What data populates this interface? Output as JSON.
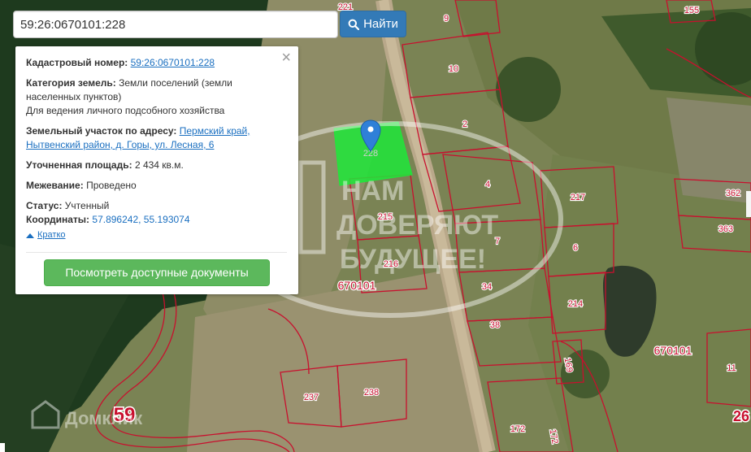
{
  "search": {
    "value": "59:26:0670101:228",
    "button_label": "Найти"
  },
  "popup": {
    "cadastral_label": "Кадастровый номер:",
    "cadastral_value": "59:26:0670101:228",
    "category_label": "Категория земель:",
    "category_value": "Земли поселений (земли населенных пунктов)",
    "usage_value": "Для ведения личного подсобного хозяйства",
    "address_label": "Земельный участок по адресу:",
    "address_value": "Пермский край, Нытвенский район, д. Горы, ул. Лесная, 6",
    "area_label": "Уточненная площадь:",
    "area_value": "2 434 кв.м.",
    "survey_label": "Межевание:",
    "survey_value": "Проведено",
    "status_label": "Статус:",
    "status_value": "Учтенный",
    "coords_label": "Координаты:",
    "coords_value": "57.896242, 55.193074",
    "collapse_label": "Кратко",
    "docs_button_label": "Посмотреть доступные документы"
  },
  "map": {
    "parcel_labels": [
      "221",
      "9",
      "155",
      "10",
      "2",
      "4",
      "217",
      "362",
      "215",
      "7",
      "6",
      "363",
      "216",
      "34",
      "214",
      "38",
      "169",
      "11",
      "237",
      "238",
      "172",
      "172",
      "228"
    ],
    "quarter_labels": [
      "670101",
      "670101"
    ],
    "region_label": "59",
    "edge_label": "26",
    "watermark_top": "НАМ",
    "watermark_mid": "ДОВЕРЯЮТ",
    "watermark_bottom": "БУДУЩЕЕ!",
    "brand_watermark": "Домклик"
  },
  "colors": {
    "boundary": "#c8102e",
    "selected_parcel": "#1ee83a",
    "marker": "#2f80d8",
    "search_button": "#337ab7",
    "docs_button": "#5cb85c"
  }
}
